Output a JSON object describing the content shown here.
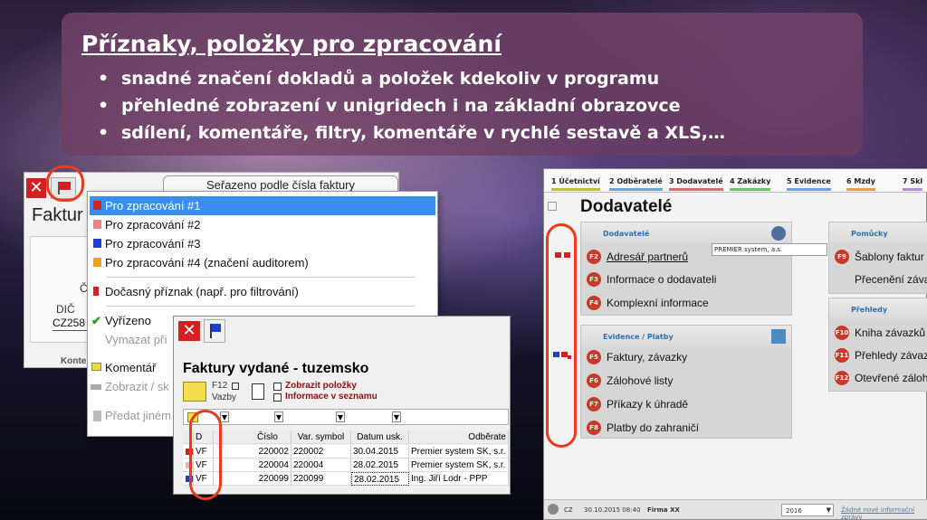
{
  "slide": {
    "title": "Příznaky, položky pro zpracování",
    "bullets": [
      "snadné značení dokladů a položek kdekoliv v programu",
      "přehledné zobrazení v unigridech i na základní obrazovce",
      "sdílení, komentáře, filtry, komentáře v rychlé sestavě a XLS,…"
    ]
  },
  "left_window": {
    "close_glyph": "✕",
    "sorted_label": "Seřazeno podle čísla faktury",
    "bg_title": "Faktur",
    "bg_c": "Č",
    "bg_dic": "DIČ",
    "bg_dic_value": "CZ258",
    "bg_kont": "Konte"
  },
  "menu": {
    "items": [
      {
        "label": "Pro zpracování #1",
        "flag": "#d42020"
      },
      {
        "label": "Pro zpracování #2",
        "flag": "#f08080"
      },
      {
        "label": "Pro zpracování #3",
        "flag": "#1f3fd0"
      },
      {
        "label": "Pro zpracování #4  (značení auditorem)",
        "flag": "#f0a020"
      },
      {
        "label": "Dočasný příznak (např. pro filtrování)",
        "flag": "#d42020"
      },
      {
        "label": "Vyřízeno",
        "check": "✔"
      },
      {
        "label": "Vymazat pří"
      },
      {
        "label": "Komentář"
      },
      {
        "label": "Zobrazit / sk"
      },
      {
        "label": "Předat jiném"
      }
    ]
  },
  "faktury": {
    "close_glyph": "✕",
    "title": "Faktury vydané - tuzemsko",
    "f12": "F12",
    "vazby": "Vazby",
    "zobrazit": "Zobrazit položky",
    "informace": "Informace v seznamu",
    "columns": [
      "D",
      "Číslo",
      "Var. symbol",
      "Datum usk.",
      "Odběrate"
    ],
    "rows": [
      {
        "flag": "#d42020",
        "d": "VF",
        "cislo": "220002",
        "vs": "220002",
        "datum": "30.04.2015",
        "odb": "Premier system SK, s.r."
      },
      {
        "flag": "#f0b0b0",
        "d": "VF",
        "cislo": "220004",
        "vs": "220004",
        "datum": "28.02.2015",
        "odb": "Premier system SK, s.r."
      },
      {
        "flag": "#1f3fd0",
        "d": "VF",
        "cislo": "220099",
        "vs": "220099",
        "datum": "28.02.2015",
        "odb": "Ing. Jiří Lodr - PPP"
      }
    ]
  },
  "right_window": {
    "tabs": [
      "1  Účetnictví",
      "2  Odběratelé",
      "3  Dodavatelé",
      "4  Zakázky",
      "5  Evidence",
      "6  Mzdy",
      "7  Skl"
    ],
    "page_title": "Dodavatelé",
    "sec1": {
      "title": "Dodavatelé",
      "items": [
        {
          "key": "F2",
          "label": "Adresář partnerů"
        },
        {
          "key": "F3",
          "label": "Informace o dodavateli"
        },
        {
          "key": "F4",
          "label": "Komplexní informace"
        }
      ]
    },
    "tooltip": "PREMIER system, a.s.",
    "sec2": {
      "title": "Evidence / Platby",
      "items": [
        {
          "key": "F5",
          "label": "Faktury, závazky"
        },
        {
          "key": "F6",
          "label": "Zálohové listy"
        },
        {
          "key": "F7",
          "label": "Příkazy k úhradě"
        },
        {
          "key": "F8",
          "label": "Platby do zahraničí"
        }
      ]
    },
    "sec3": {
      "title": "Pomůcky",
      "items": [
        {
          "key": "F9",
          "label": "Šablony faktur"
        },
        {
          "key": "",
          "label": "Přecenění závaz"
        }
      ]
    },
    "sec4": {
      "title": "Přehledy",
      "items": [
        {
          "key": "F10",
          "label": "Kniha závazků"
        },
        {
          "key": "F11",
          "label": "Přehledy závaz"
        },
        {
          "key": "F12",
          "label": "Otevřené záloh"
        }
      ]
    },
    "status": {
      "cz": "CZ",
      "datetime": "30.10.2015  08:40",
      "firma": "Firma XX",
      "year": "2016",
      "message": "Žádné nové informační zprávy"
    }
  }
}
